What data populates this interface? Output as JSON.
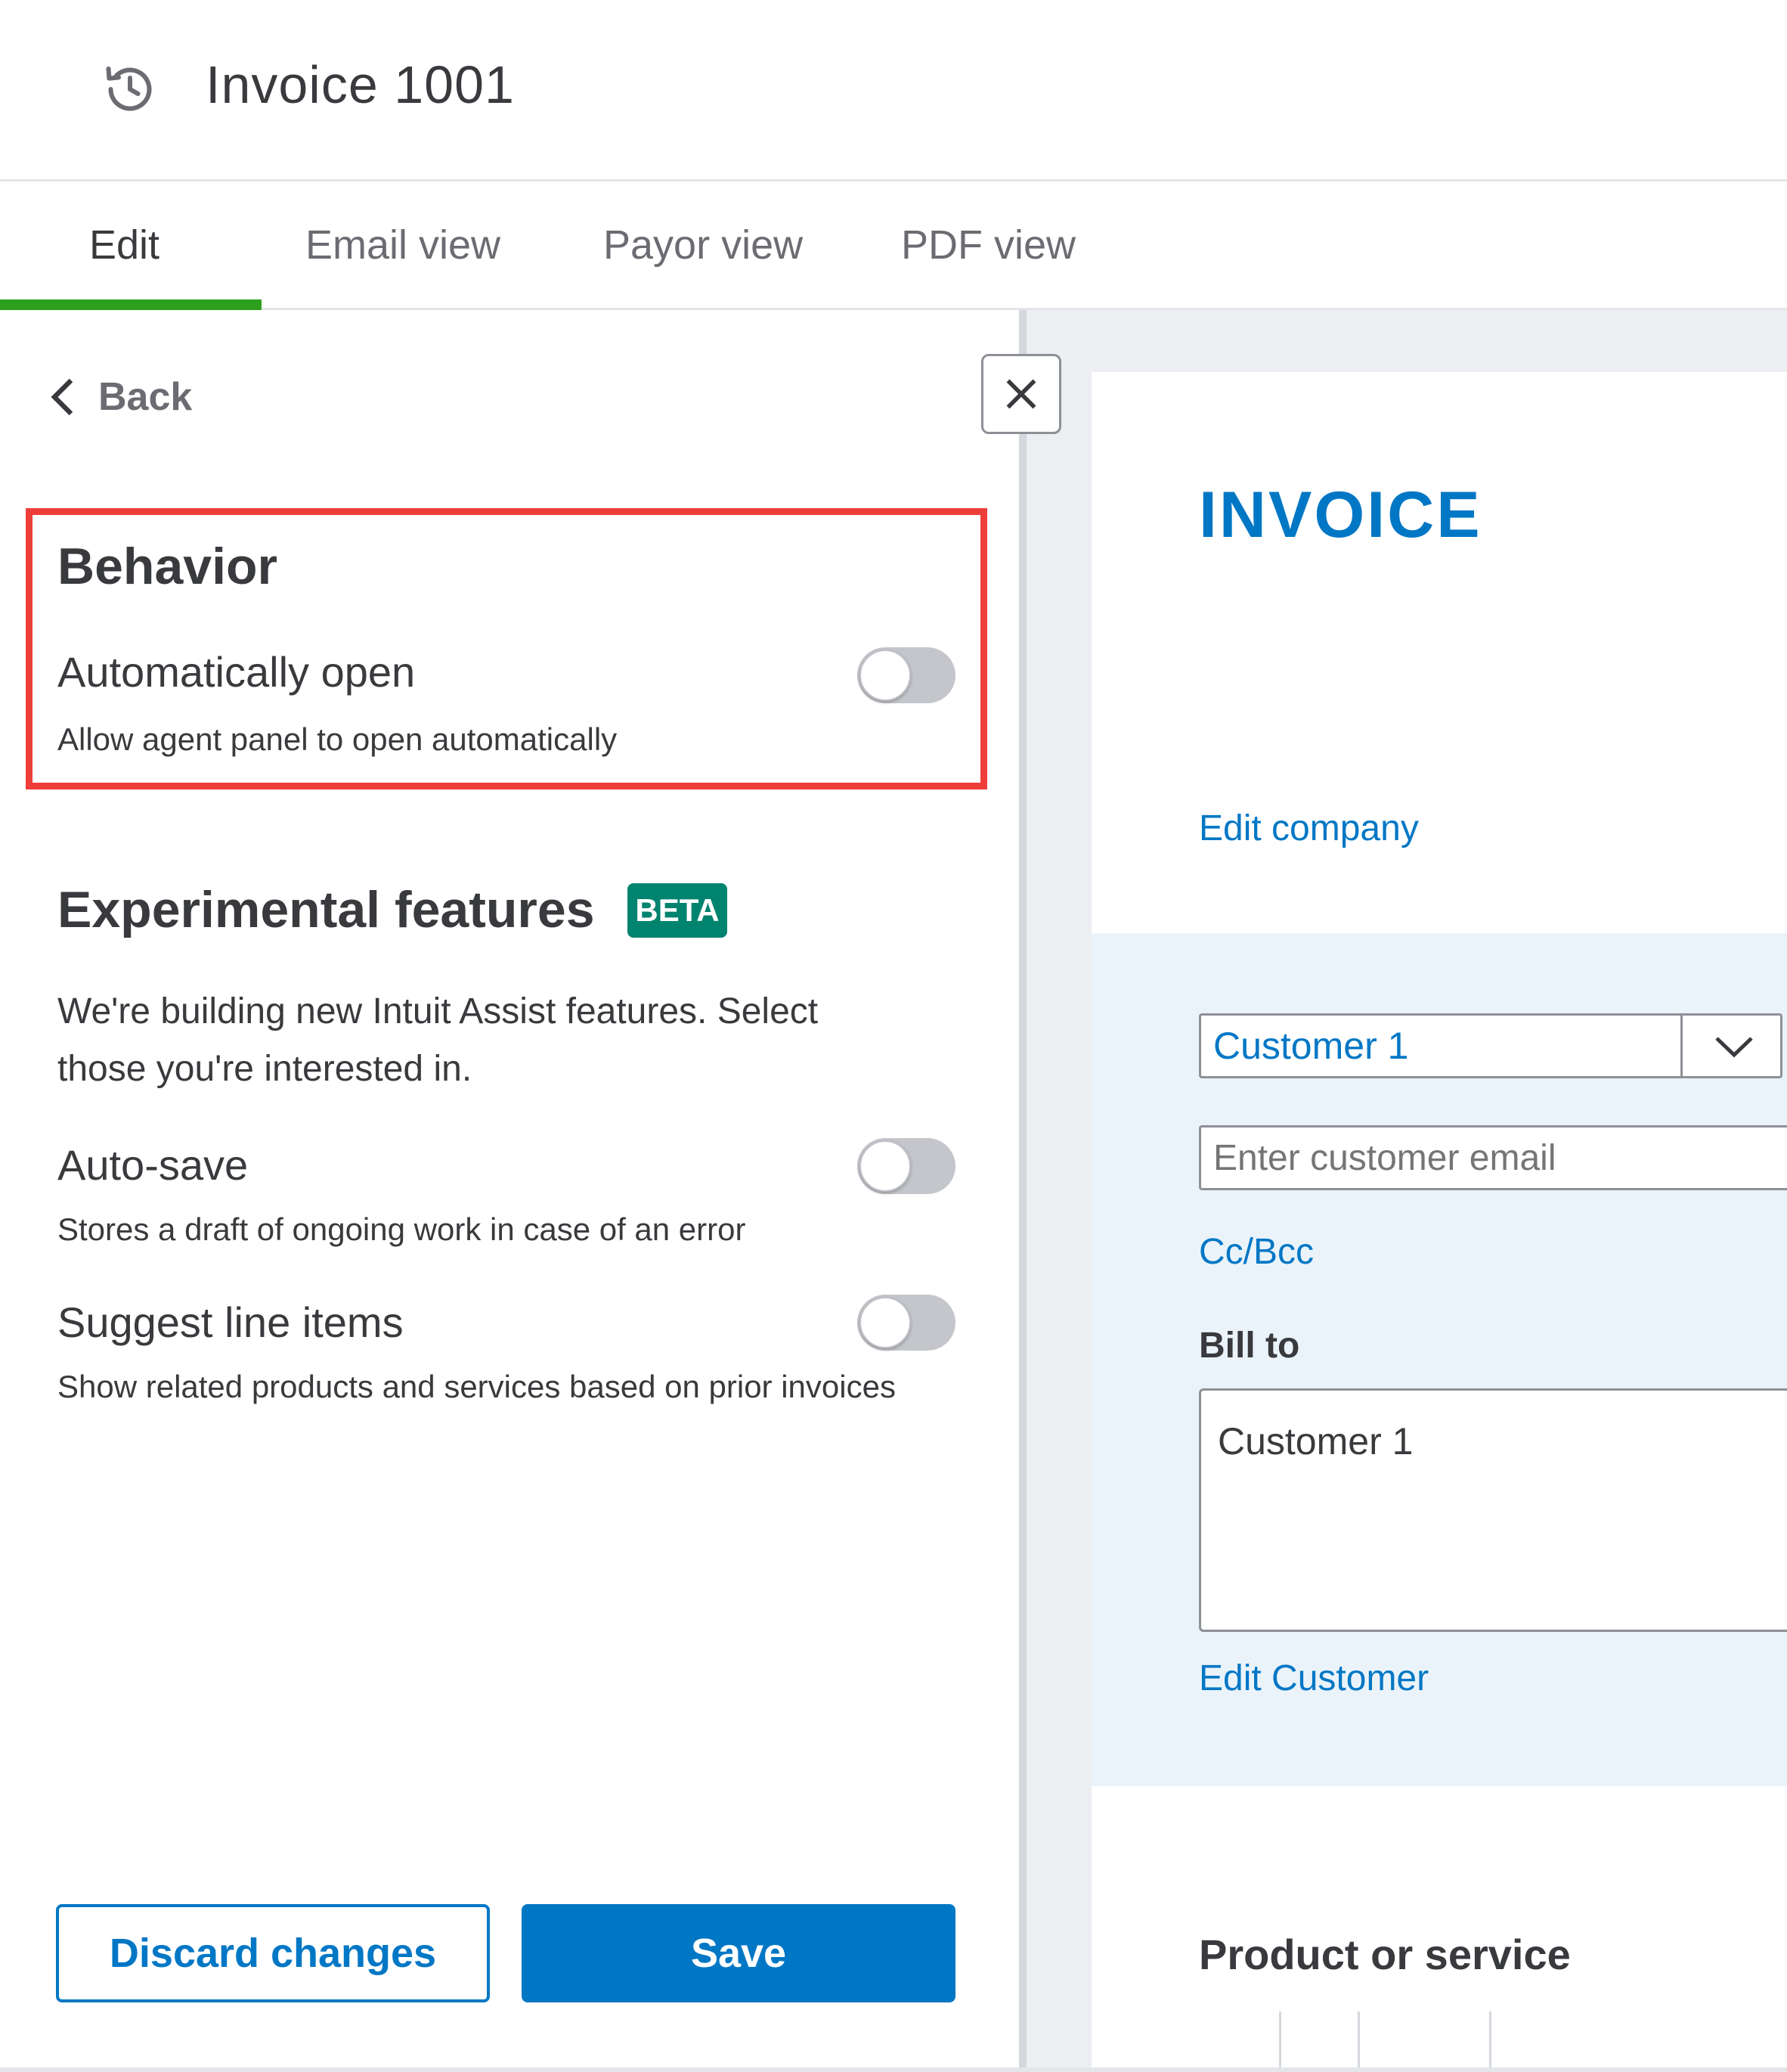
{
  "header": {
    "title": "Invoice 1001",
    "history_icon": "history-icon"
  },
  "tabs": [
    {
      "label": "Edit",
      "active": true
    },
    {
      "label": "Email view",
      "active": false
    },
    {
      "label": "Payor view",
      "active": false
    },
    {
      "label": "PDF view",
      "active": false
    }
  ],
  "settings_panel": {
    "back_label": "Back",
    "behavior": {
      "title": "Behavior",
      "items": [
        {
          "label": "Automatically open",
          "description": "Allow agent panel to open automatically",
          "enabled": false
        }
      ]
    },
    "experimental": {
      "title": "Experimental features",
      "badge": "BETA",
      "intro_line1": "We're building new Intuit Assist features. Select",
      "intro_line2": "those you're interested in.",
      "items": [
        {
          "label": "Auto-save",
          "description": "Stores a draft of ongoing work in case of an error",
          "enabled": false
        },
        {
          "label": "Suggest line items",
          "description": "Show related products and services based on prior invoices",
          "enabled": false
        }
      ]
    },
    "buttons": {
      "discard": "Discard changes",
      "save": "Save"
    }
  },
  "invoice_preview": {
    "heading": "INVOICE",
    "edit_company": "Edit company",
    "customer_select": "Customer 1",
    "email_placeholder": "Enter customer email",
    "cc_bcc": "Cc/Bcc",
    "bill_to_label": "Bill to",
    "bill_to_value": "Customer 1",
    "edit_customer": "Edit Customer",
    "product_heading": "Product or service"
  },
  "colors": {
    "accent_green": "#2ca01c",
    "primary_blue": "#0077c5",
    "highlight_red": "#ee3e3a",
    "beta_teal": "#00836f"
  }
}
